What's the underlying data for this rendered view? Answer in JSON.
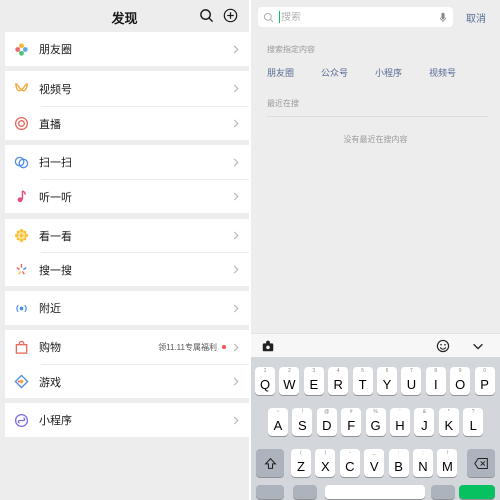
{
  "left": {
    "title": "发现",
    "items": [
      {
        "label": "朋友圈",
        "icon": "moments-icon"
      },
      {
        "label": "视频号",
        "icon": "channels-icon"
      },
      {
        "label": "直播",
        "icon": "live-icon"
      },
      {
        "label": "扫一扫",
        "icon": "scan-icon"
      },
      {
        "label": "听一听",
        "icon": "listen-icon"
      },
      {
        "label": "看一看",
        "icon": "top-stories-icon"
      },
      {
        "label": "搜一搜",
        "icon": "search-discover-icon"
      },
      {
        "label": "附近",
        "icon": "nearby-icon"
      },
      {
        "label": "购物",
        "icon": "shopping-icon",
        "extra": "领11.11专属福利"
      },
      {
        "label": "游戏",
        "icon": "games-icon"
      },
      {
        "label": "小程序",
        "icon": "mini-programs-icon"
      }
    ]
  },
  "right": {
    "search": {
      "placeholder": "搜索"
    },
    "cancel": "取消",
    "hint": "搜索指定内容",
    "categories": [
      "朋友圈",
      "公众号",
      "小程序",
      "视频号"
    ],
    "recent": "最近在搜",
    "empty": "没有最近在搜内容"
  },
  "keyboard": {
    "row1": [
      {
        "n": "1",
        "c": "Q"
      },
      {
        "n": "2",
        "c": "W"
      },
      {
        "n": "3",
        "c": "E"
      },
      {
        "n": "4",
        "c": "R"
      },
      {
        "n": "5",
        "c": "T"
      },
      {
        "n": "6",
        "c": "Y"
      },
      {
        "n": "7",
        "c": "U"
      },
      {
        "n": "8",
        "c": "I"
      },
      {
        "n": "9",
        "c": "O"
      },
      {
        "n": "0",
        "c": "P"
      }
    ],
    "row2": [
      {
        "n": "~",
        "c": "A"
      },
      {
        "n": "!",
        "c": "S"
      },
      {
        "n": "@",
        "c": "D"
      },
      {
        "n": "#",
        "c": "F"
      },
      {
        "n": "%",
        "c": "G"
      },
      {
        "n": "'",
        "c": "H"
      },
      {
        "n": "&",
        "c": "J"
      },
      {
        "n": "*",
        "c": "K"
      },
      {
        "n": "?",
        "c": "L"
      }
    ],
    "row3": [
      {
        "n": "(",
        "c": "Z"
      },
      {
        "n": ")",
        "c": "X"
      },
      {
        "n": "-",
        "c": "C"
      },
      {
        "n": "_",
        "c": "V"
      },
      {
        "n": ":",
        "c": "B"
      },
      {
        "n": ";",
        "c": "N"
      },
      {
        "n": "/",
        "c": "M"
      }
    ]
  },
  "colors": {
    "accent_link": "#576b95",
    "green": "#07c160",
    "red_dot": "#fa5151",
    "bg": "#ededed"
  }
}
